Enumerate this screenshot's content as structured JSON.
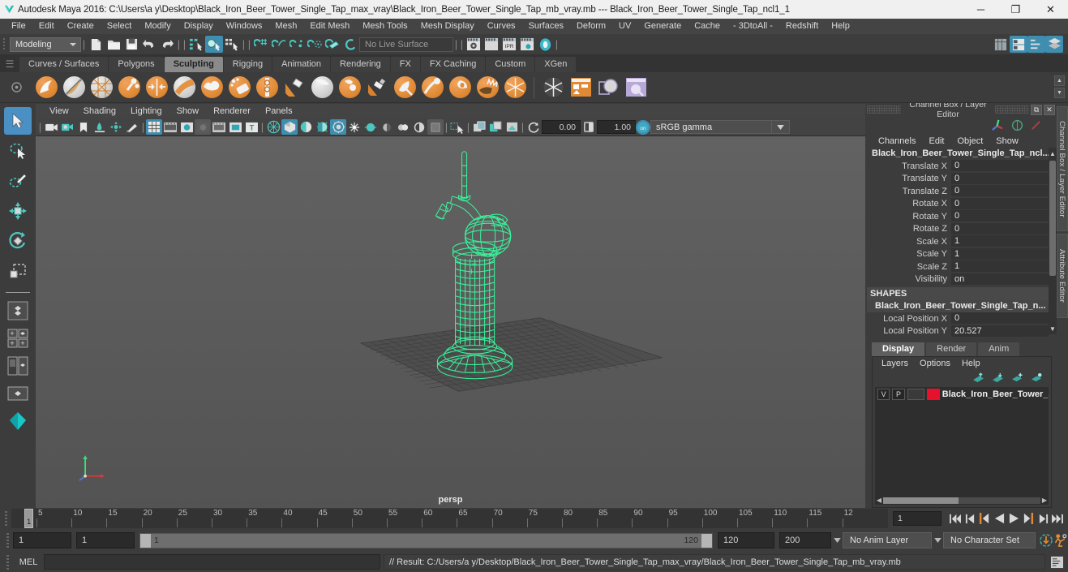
{
  "window": {
    "title": "Autodesk Maya 2016: C:\\Users\\a y\\Desktop\\Black_Iron_Beer_Tower_Single_Tap_max_vray\\Black_Iron_Beer_Tower_Single_Tap_mb_vray.mb  ---  Black_Iron_Beer_Tower_Single_Tap_ncl1_1",
    "minimize": "─",
    "maximize": "❐",
    "close": "✕",
    "logo_icon": "maya-logo-icon"
  },
  "menubar": {
    "items": [
      "File",
      "Edit",
      "Create",
      "Select",
      "Modify",
      "Display",
      "Windows",
      "Mesh",
      "Edit Mesh",
      "Mesh Tools",
      "Mesh Display",
      "Curves",
      "Surfaces",
      "Deform",
      "UV",
      "Generate",
      "Cache",
      "- 3DtoAll -",
      "Redshift",
      "Help"
    ]
  },
  "statusbar": {
    "mode": "Modeling",
    "live_surface": "No Live Surface",
    "icons_file": [
      "new-scene-icon",
      "open-scene-icon",
      "save-scene-icon",
      "undo-icon",
      "redo-icon"
    ],
    "icons_select": [
      "select-by-hierarchy-icon",
      "select-by-object-type-icon",
      "select-by-component-type-icon"
    ],
    "icons_snap": [
      "snap-to-grid-icon",
      "snap-to-curve-icon",
      "snap-to-point-icon",
      "snap-to-projected-center-icon",
      "snap-to-view-plane-icon",
      "make-live-icon"
    ],
    "icons_render": [
      "render-current-frame-icon",
      "render-sequence-icon",
      "ipr-render-icon",
      "render-settings-icon",
      "hypershade-icon"
    ],
    "icons_right": [
      "show-hide-editors-icon",
      "attribute-editor-icon",
      "tool-settings-icon",
      "channel-box-icon"
    ]
  },
  "shelf": {
    "tabs": [
      "Curves / Surfaces",
      "Polygons",
      "Sculpting",
      "Rigging",
      "Animation",
      "Rendering",
      "FX",
      "FX Caching",
      "Custom",
      "XGen"
    ],
    "active_tab": "Sculpting",
    "tools": [
      {
        "name": "sculpt-tool-icon",
        "kind": "orange"
      },
      {
        "name": "smooth-tool-icon",
        "kind": "grey"
      },
      {
        "name": "relax-tool-icon",
        "kind": "grey"
      },
      {
        "name": "grab-tool-icon",
        "kind": "orange"
      },
      {
        "name": "pinch-tool-icon",
        "kind": "orange"
      },
      {
        "name": "flatten-tool-icon",
        "kind": "grey"
      },
      {
        "name": "foamy-tool-icon",
        "kind": "orange"
      },
      {
        "name": "spray-tool-icon",
        "kind": "orange"
      },
      {
        "name": "repeat-tool-icon",
        "kind": "orange"
      },
      {
        "name": "imprint-tool-icon",
        "kind": "orange"
      },
      {
        "name": "wax-tool-icon",
        "kind": "grey"
      },
      {
        "name": "scrape-tool-icon",
        "kind": "orange"
      },
      {
        "name": "fill-tool-icon",
        "kind": "orange"
      },
      {
        "name": "knife-tool-icon",
        "kind": "orange"
      },
      {
        "name": "smear-tool-icon",
        "kind": "orange"
      },
      {
        "name": "bulge-tool-icon",
        "kind": "orange"
      },
      {
        "name": "amplify-tool-icon",
        "kind": "orange"
      },
      {
        "name": "freeze-tool-icon",
        "kind": "orange"
      },
      {
        "name": "convert-tool-icon",
        "kind": "orange"
      }
    ],
    "panel_icons": [
      "freeze-selection-icon",
      "sculpt-settings-icon",
      "mirror-tool-icon",
      "clone-target-icon"
    ]
  },
  "viewport": {
    "menus": [
      "View",
      "Shading",
      "Lighting",
      "Show",
      "Renderer",
      "Panels"
    ],
    "toolbar_icons": [
      "select-camera-icon",
      "camera-attributes-icon",
      "bookmark-icon",
      "image-plane-icon",
      "2d-pan-zoom-icon",
      "grease-pencil-icon",
      "grid-toggle-icon",
      "film-gate-icon",
      "resolution-gate-icon",
      "gate-mask-icon",
      "film-origin-icon",
      "xray-icon",
      "text-overlay-icon",
      "wireframe-shading-icon",
      "smooth-shade-all-icon",
      "shade-textured-icon",
      "use-all-lights-icon",
      "shadows-icon",
      "ao-icon",
      "motion-blur-icon",
      "multisample-icon",
      "depth-of-field-icon",
      "isolate-select-icon",
      "xray-joints-icon",
      "xray-active-components-icon",
      "exposure-reset-icon"
    ],
    "exposure_value": "0.00",
    "gamma_value": "1.00",
    "color_profile": "sRGB gamma",
    "camera_label": "persp",
    "object_color": "#39f09a"
  },
  "channelbox": {
    "panel_title": "Channel Box / Layer Editor",
    "menus": [
      "Channels",
      "Edit",
      "Object",
      "Show"
    ],
    "object_name": "Black_Iron_Beer_Tower_Single_Tap_ncl...",
    "transform_rows": [
      {
        "label": "Translate X",
        "value": "0"
      },
      {
        "label": "Translate Y",
        "value": "0"
      },
      {
        "label": "Translate Z",
        "value": "0"
      },
      {
        "label": "Rotate X",
        "value": "0"
      },
      {
        "label": "Rotate Y",
        "value": "0"
      },
      {
        "label": "Rotate Z",
        "value": "0"
      },
      {
        "label": "Scale X",
        "value": "1"
      },
      {
        "label": "Scale Y",
        "value": "1"
      },
      {
        "label": "Scale Z",
        "value": "1"
      },
      {
        "label": "Visibility",
        "value": "on"
      }
    ],
    "shapes_header": "SHAPES",
    "shape_name": "Black_Iron_Beer_Tower_Single_Tap_n...",
    "shape_rows": [
      {
        "label": "Local Position X",
        "value": "0"
      },
      {
        "label": "Local Position Y",
        "value": "20.527"
      }
    ],
    "side_tabs": [
      "Channel Box / Layer Editor",
      "Attribute Editor"
    ]
  },
  "layereditor": {
    "tabs": [
      "Display",
      "Render",
      "Anim"
    ],
    "active_tab": "Display",
    "menus": [
      "Layers",
      "Options",
      "Help"
    ],
    "toolbar_icons": [
      "move-layer-up-icon",
      "move-layer-down-icon",
      "new-layer-icon",
      "new-layer-from-selected-icon"
    ],
    "layers": [
      {
        "visibility": "V",
        "playback": "P",
        "type": "",
        "color": "#e8112d",
        "name": "Black_Iron_Beer_Tower_S"
      }
    ]
  },
  "timeline": {
    "ticks": [
      "5",
      "10",
      "15",
      "20",
      "25",
      "30",
      "35",
      "40",
      "45",
      "50",
      "55",
      "60",
      "65",
      "70",
      "75",
      "80",
      "85",
      "90",
      "95",
      "100",
      "105",
      "110",
      "115",
      "12"
    ],
    "current_frame": "1",
    "current_frame_field": "1",
    "playback_buttons": [
      "go-to-start-icon",
      "step-back-keyframe-icon",
      "step-back-frame-icon",
      "play-backwards-icon",
      "play-forwards-icon",
      "step-forward-frame-icon",
      "step-forward-keyframe-icon",
      "go-to-end-icon"
    ]
  },
  "range": {
    "anim_start": "1",
    "range_start": "1",
    "slider_left_label": "1",
    "slider_right_label": "120",
    "range_end": "120",
    "anim_end": "200",
    "anim_layer": "No Anim Layer",
    "character_set": "No Character Set",
    "icons": [
      "auto-key-icon",
      "animation-preferences-icon"
    ]
  },
  "mel": {
    "label": "MEL",
    "input_value": "",
    "result_text": "// Result: C:/Users/a y/Desktop/Black_Iron_Beer_Tower_Single_Tap_max_vray/Black_Iron_Beer_Tower_Single_Tap_mb_vray.mb",
    "script_editor_icon": "script-editor-icon"
  },
  "toolbox": {
    "tools": [
      "select-tool-icon",
      "lasso-select-tool-icon",
      "paint-select-tool-icon",
      "move-tool-icon",
      "rotate-tool-icon",
      "scale-tool-icon"
    ],
    "layouts": [
      "single-perspective-layout-icon",
      "four-view-layout-icon",
      "two-pane-side-layout-icon",
      "two-pane-stacked-layout-icon",
      "outliner-persp-layout-icon"
    ]
  }
}
